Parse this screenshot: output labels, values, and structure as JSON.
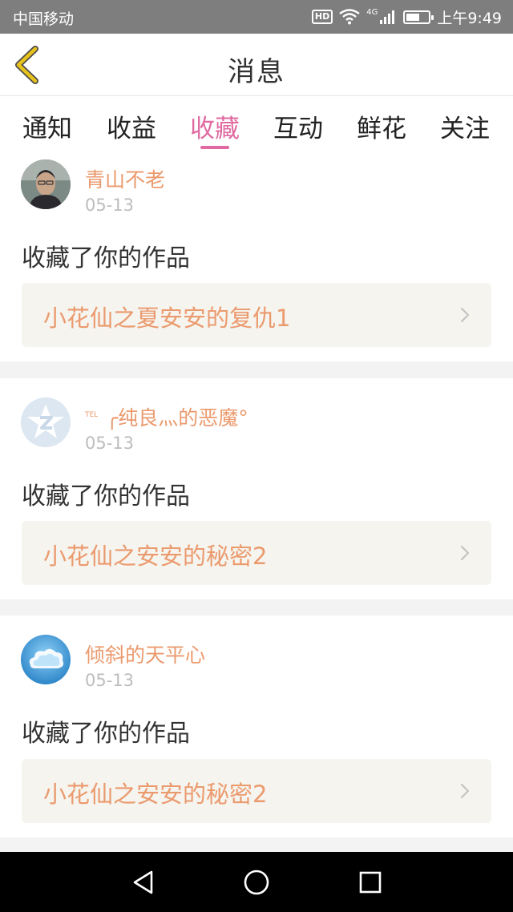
{
  "status_bar": {
    "carrier": "中国移动",
    "hd_label": "HD",
    "network": "4G",
    "time": "上午9:49",
    "battery_level": 0.6,
    "icons": [
      "hd-icon",
      "wifi-icon",
      "signal-icon",
      "battery-icon"
    ]
  },
  "header": {
    "title": "消息",
    "back_icon": "chevron-left-icon",
    "accent_color": "#e0b800"
  },
  "tabs": [
    {
      "label": "通知",
      "active": false
    },
    {
      "label": "收益",
      "active": false
    },
    {
      "label": "收藏",
      "active": true
    },
    {
      "label": "互动",
      "active": false
    },
    {
      "label": "鲜花",
      "active": false
    },
    {
      "label": "关注",
      "active": false
    }
  ],
  "colors": {
    "tab_active": "#e06aa1",
    "username": "#eb9a6e",
    "work_title": "#eb9a6e",
    "work_box_bg": "#f5f4ee"
  },
  "messages": [
    {
      "username": "青山不老",
      "date": "05-13",
      "action": "收藏了你的作品",
      "work_title": "小花仙之夏安安的复仇1",
      "avatar": "photo-avatar"
    },
    {
      "username_prefix": "TEL",
      "username": "╭纯良灬的恶魔°",
      "date": "05-13",
      "action": "收藏了你的作品",
      "work_title": "小花仙之安安的秘密2",
      "avatar": "qzone-avatar"
    },
    {
      "username": "倾斜的天平心",
      "date": "05-13",
      "action": "收藏了你的作品",
      "work_title": "小花仙之安安的秘密2",
      "avatar": "cloud-avatar"
    }
  ],
  "nav_bar": {
    "icons": [
      "back-triangle-icon",
      "home-circle-icon",
      "recents-square-icon"
    ]
  }
}
